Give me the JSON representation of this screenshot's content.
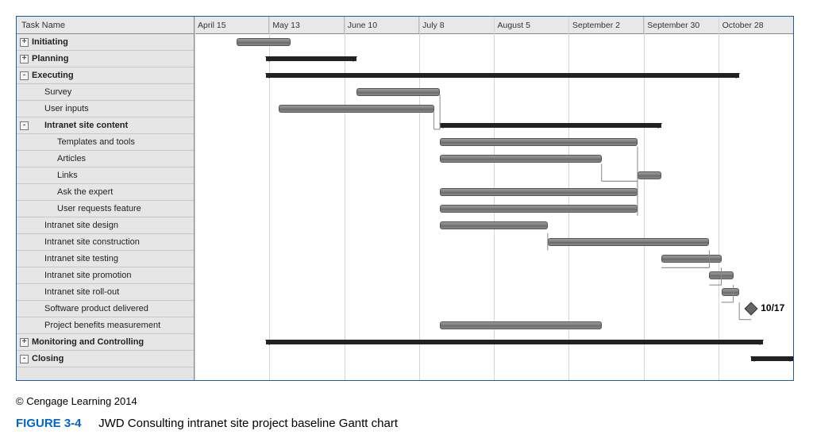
{
  "chart_data": {
    "type": "bar",
    "title": "JWD Consulting intranet site project baseline Gantt chart",
    "timeline": {
      "start": 0,
      "categories": [
        "April 15",
        "May 13",
        "June 10",
        "July 8",
        "August 5",
        "September 2",
        "September 30",
        "October 28"
      ]
    },
    "tasks": [
      {
        "name": "Initiating",
        "bold": true,
        "indent": 0,
        "expander": "+",
        "style": "task",
        "start": 7,
        "end": 16
      },
      {
        "name": "Planning",
        "bold": true,
        "indent": 0,
        "expander": "+",
        "style": "summary",
        "start": 12,
        "end": 27
      },
      {
        "name": "Executing",
        "bold": true,
        "indent": 0,
        "expander": "-",
        "style": "summary",
        "start": 12,
        "end": 91
      },
      {
        "name": "Survey",
        "bold": false,
        "indent": 1,
        "expander": "",
        "style": "task",
        "start": 27,
        "end": 41
      },
      {
        "name": "User inputs",
        "bold": false,
        "indent": 1,
        "expander": "",
        "style": "task",
        "start": 14,
        "end": 40
      },
      {
        "name": "Intranet site content",
        "bold": true,
        "indent": 1,
        "expander": "-",
        "style": "summary",
        "start": 41,
        "end": 78
      },
      {
        "name": "Templates and tools",
        "bold": false,
        "indent": 2,
        "expander": "",
        "style": "task",
        "start": 41,
        "end": 74
      },
      {
        "name": "Articles",
        "bold": false,
        "indent": 2,
        "expander": "",
        "style": "task",
        "start": 41,
        "end": 68
      },
      {
        "name": "Links",
        "bold": false,
        "indent": 2,
        "expander": "",
        "style": "task",
        "start": 74,
        "end": 78
      },
      {
        "name": "Ask the expert",
        "bold": false,
        "indent": 2,
        "expander": "",
        "style": "task",
        "start": 41,
        "end": 74
      },
      {
        "name": "User requests feature",
        "bold": false,
        "indent": 2,
        "expander": "",
        "style": "task",
        "start": 41,
        "end": 74
      },
      {
        "name": "Intranet site design",
        "bold": false,
        "indent": 1,
        "expander": "",
        "style": "task",
        "start": 41,
        "end": 59
      },
      {
        "name": "Intranet site construction",
        "bold": false,
        "indent": 1,
        "expander": "",
        "style": "task",
        "start": 59,
        "end": 86
      },
      {
        "name": "Intranet site testing",
        "bold": false,
        "indent": 1,
        "expander": "",
        "style": "task",
        "start": 78,
        "end": 88
      },
      {
        "name": "Intranet site promotion",
        "bold": false,
        "indent": 1,
        "expander": "",
        "style": "task",
        "start": 86,
        "end": 90
      },
      {
        "name": "Intranet site roll-out",
        "bold": false,
        "indent": 1,
        "expander": "",
        "style": "task",
        "start": 88,
        "end": 91
      },
      {
        "name": "Software product delivered",
        "bold": false,
        "indent": 1,
        "expander": "",
        "style": "milestone",
        "start": 93,
        "end": 93,
        "label": "10/17"
      },
      {
        "name": "Project benefits measurement",
        "bold": false,
        "indent": 1,
        "expander": "",
        "style": "task",
        "start": 41,
        "end": 68
      },
      {
        "name": "Monitoring and Controlling",
        "bold": true,
        "indent": 0,
        "expander": "+",
        "style": "summary",
        "start": 12,
        "end": 95
      },
      {
        "name": "Closing",
        "bold": true,
        "indent": 0,
        "expander": "-",
        "style": "summary",
        "start": 93,
        "end": 100
      }
    ],
    "columns": {
      "task_header": "Task Name"
    }
  },
  "caption": {
    "copyright": "© Cengage Learning 2014",
    "fig_label": "FIGURE 3-4",
    "fig_title": "JWD Consulting intranet site project baseline Gantt chart"
  }
}
